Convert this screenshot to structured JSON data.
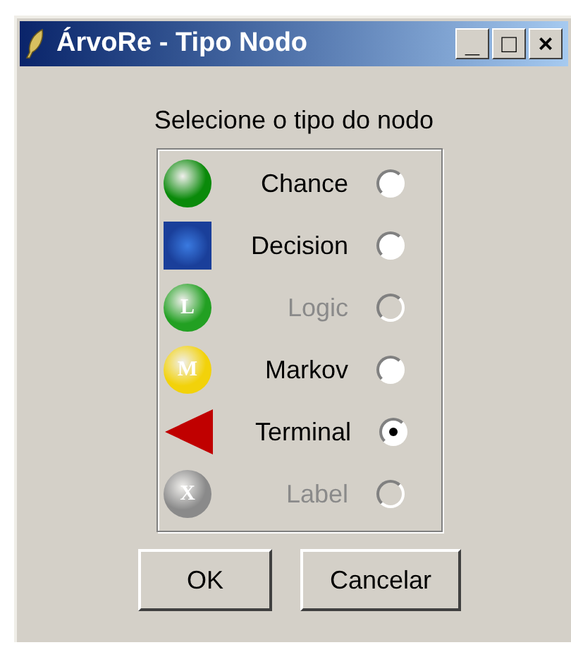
{
  "window": {
    "title": "ÁrvoRe - Tipo Nodo",
    "controls": [
      "_",
      "□",
      "×"
    ]
  },
  "prompt": "Selecione o tipo do nodo",
  "options": [
    {
      "label": "Chance",
      "kind": "circle",
      "color": "#0a8a0a",
      "disabled": false,
      "selected": false
    },
    {
      "label": "Decision",
      "kind": "square",
      "color": "#1a3f9a",
      "disabled": false,
      "selected": false
    },
    {
      "label": "Logic",
      "kind": "circle",
      "color": "#22a022",
      "letter": "L",
      "disabled": true,
      "selected": false
    },
    {
      "label": "Markov",
      "kind": "circle",
      "color": "#f2d20a",
      "letter": "M",
      "disabled": false,
      "selected": false
    },
    {
      "label": "Terminal",
      "kind": "triangle",
      "color": "#c00000",
      "disabled": false,
      "selected": true
    },
    {
      "label": "Label",
      "kind": "circle",
      "color": "#8a8a8a",
      "letter": "X",
      "disabled": true,
      "selected": false
    }
  ],
  "buttons": [
    "OK",
    "Cancelar"
  ]
}
